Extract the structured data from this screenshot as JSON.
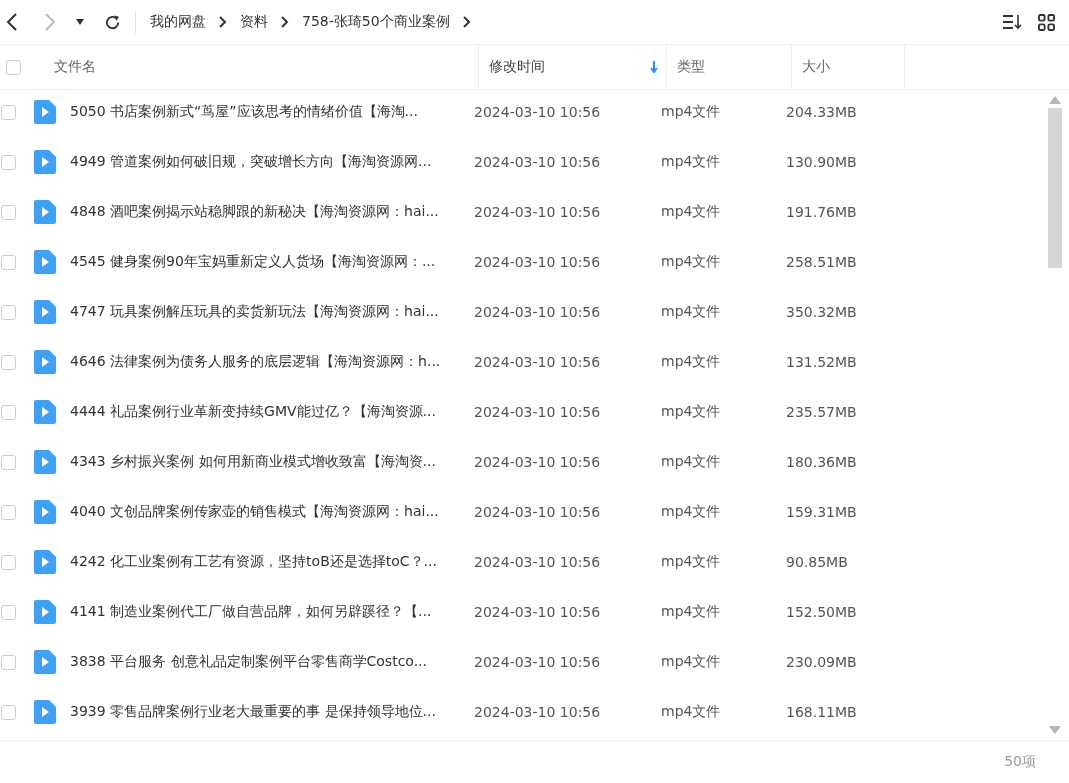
{
  "breadcrumb": [
    "我的网盘",
    "资料",
    "758-张琦50个商业案例"
  ],
  "header": {
    "checked": false,
    "columns": [
      {
        "label": "文件名",
        "sorted": false
      },
      {
        "label": "修改时间",
        "sorted": true
      },
      {
        "label": "类型",
        "sorted": false
      },
      {
        "label": "大小",
        "sorted": false
      }
    ]
  },
  "rows": [
    {
      "checked": false,
      "name": "5050 书店案例新式“茑屋”应该思考的情绪价值【海淘...",
      "modified": "2024-03-10 10:56",
      "type": "mp4文件",
      "size": "204.33MB"
    },
    {
      "checked": false,
      "name": "4949 管道案例如何破旧规，突破增长方向【海淘资源网...",
      "modified": "2024-03-10 10:56",
      "type": "mp4文件",
      "size": "130.90MB"
    },
    {
      "checked": false,
      "name": "4848 酒吧案例揭示站稳脚跟的新秘决【海淘资源网：hai...",
      "modified": "2024-03-10 10:56",
      "type": "mp4文件",
      "size": "191.76MB"
    },
    {
      "checked": false,
      "name": "4545 健身案例90年宝妈重新定义人货场【海淘资源网：...",
      "modified": "2024-03-10 10:56",
      "type": "mp4文件",
      "size": "258.51MB"
    },
    {
      "checked": false,
      "name": "4747 玩具案例解压玩具的卖货新玩法【海淘资源网：hai...",
      "modified": "2024-03-10 10:56",
      "type": "mp4文件",
      "size": "350.32MB"
    },
    {
      "checked": false,
      "name": "4646 法律案例为债务人服务的底层逻辑【海淘资源网：h...",
      "modified": "2024-03-10 10:56",
      "type": "mp4文件",
      "size": "131.52MB"
    },
    {
      "checked": false,
      "name": "4444 礼品案例行业革新变持续GMV能过亿？【海淘资源...",
      "modified": "2024-03-10 10:56",
      "type": "mp4文件",
      "size": "235.57MB"
    },
    {
      "checked": false,
      "name": "4343 乡村振兴案例 如何用新商业模式增收致富【海淘资...",
      "modified": "2024-03-10 10:56",
      "type": "mp4文件",
      "size": "180.36MB"
    },
    {
      "checked": false,
      "name": "4040 文创品牌案例传家壶的销售模式【海淘资源网：hai...",
      "modified": "2024-03-10 10:56",
      "type": "mp4文件",
      "size": "159.31MB"
    },
    {
      "checked": false,
      "name": "4242 化工业案例有工艺有资源，坚持toB还是选择toC？...",
      "modified": "2024-03-10 10:56",
      "type": "mp4文件",
      "size": "90.85MB"
    },
    {
      "checked": false,
      "name": "4141 制造业案例代工厂做自营品牌，如何另辟蹊径？【...",
      "modified": "2024-03-10 10:56",
      "type": "mp4文件",
      "size": "152.50MB"
    },
    {
      "checked": false,
      "name": "3838 平台服务 创意礼品定制案例平台零售商学Costco...",
      "modified": "2024-03-10 10:56",
      "type": "mp4文件",
      "size": "230.09MB"
    },
    {
      "checked": false,
      "name": "3939 零售品牌案例行业老大最重要的事 是保持领导地位...",
      "modified": "2024-03-10 10:56",
      "type": "mp4文件",
      "size": "168.11MB"
    }
  ],
  "footer": {
    "count": "50项"
  }
}
